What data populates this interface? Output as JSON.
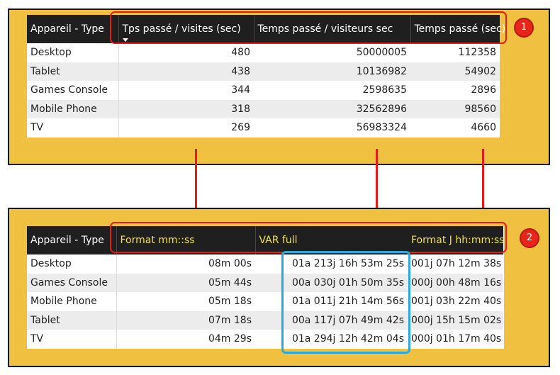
{
  "table1": {
    "headers": [
      "Appareil - Type",
      "Tps passé / visites (sec)",
      "Temps passé / visiteurs sec",
      "Temps passé (sec)"
    ],
    "rows": [
      [
        "Desktop",
        "480",
        "50000005",
        "112358"
      ],
      [
        "Tablet",
        "438",
        "10136982",
        "54902"
      ],
      [
        "Games Console",
        "344",
        "2598635",
        "2896"
      ],
      [
        "Mobile Phone",
        "318",
        "32562896",
        "98560"
      ],
      [
        "TV",
        "269",
        "56983324",
        "4660"
      ]
    ]
  },
  "table2": {
    "headers": [
      "Appareil - Type",
      "Format mm::ss",
      "VAR full",
      "Format J hh:mm:ss"
    ],
    "rows": [
      [
        "Desktop",
        "08m 00s",
        "01a 213j 16h 53m 25s",
        "001j 07h 12m 38s"
      ],
      [
        "Games Console",
        "05m 44s",
        "00a 030j 01h 50m 35s",
        "000j 00h 48m 16s"
      ],
      [
        "Mobile Phone",
        "05m 18s",
        "01a 011j 21h 14m 56s",
        "001j 03h 22m 40s"
      ],
      [
        "Tablet",
        "07m 18s",
        "00a 117j 07h 49m 42s",
        "000j 15h 15m 02s"
      ],
      [
        "TV",
        "04m 29s",
        "01a 294j 12h 42m 04s",
        "000j 01h 17m 40s"
      ]
    ]
  },
  "badges": [
    "1",
    "2"
  ],
  "colors": {
    "panel": "#f0c140",
    "header": "#1f1f1f",
    "header_text_2": "#f2e23a",
    "annotation_red": "#e21b1b",
    "highlight_blue": "#29a9e0"
  }
}
